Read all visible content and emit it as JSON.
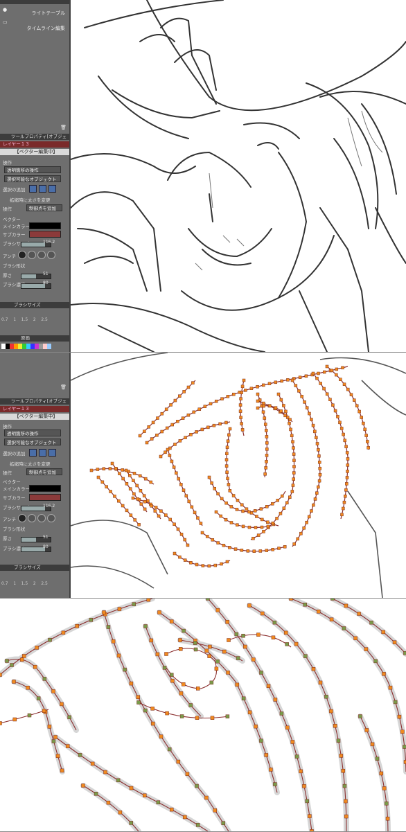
{
  "panel1": {
    "light_table": "ライトテーブル",
    "timeline_edit": "タイムライン編集",
    "tool_property": "ツールプロパティ[オブジェ",
    "layer": "レイヤー１３",
    "editing_banner": "【ベクター編集中】",
    "operation_header": "操作",
    "op_transparent": "透明箇所の操作",
    "op_selectable": "選択可能なオブジェクト",
    "add_selection": "選択の追加",
    "checkbox_thickness": "拡縮時に太さを変更",
    "operation_label": "操作",
    "operation_value": "制御点を追加",
    "vector_header": "ベクター",
    "main_color": "メインカラー",
    "sub_color": "サブカラー",
    "brush_size": "ブラシサイズ",
    "brush_size_value": "116.2",
    "antialias": "アンチ",
    "brush_shape": "ブラシ形状",
    "thickness": "厚さ",
    "thickness_value": "51",
    "brush_density": "ブラシ濃度",
    "brush_density_value": "80",
    "brush_size_panel": "ブラシサイズ",
    "ticks": [
      "0.7",
      "1",
      "1.5",
      "2",
      "2.5"
    ],
    "canvas_tab": "原画"
  },
  "panel2": {
    "tool_property": "ツールプロパティ[オブジェ",
    "layer": "レイヤー１３",
    "editing_banner": "【ベクター編集中】",
    "operation_header": "操作",
    "op_transparent": "透明箇所の操作",
    "op_selectable": "選択可能なオブジェクト",
    "add_selection": "選択の追加",
    "checkbox_thickness": "拡縮時に太さを変更",
    "operation_label": "操作",
    "operation_value": "制御点を追加",
    "vector_header": "ベクター",
    "main_color": "メインカラー",
    "sub_color": "サブカラー",
    "brush_size": "ブラシサイズ",
    "brush_size_value": "116.2",
    "antialias": "アンチ",
    "brush_shape": "ブラシ形状",
    "thickness": "厚さ",
    "thickness_value": "51",
    "brush_density": "ブラシ濃度",
    "brush_density_value": "80",
    "brush_size_panel": "ブラシサイズ",
    "ticks": [
      "0.7",
      "1",
      "1.5",
      "2",
      "2.5"
    ]
  },
  "colors": {
    "panel_bg": "#6e6e6e",
    "main_color": "#000000",
    "sub_color": "#8b3a3a",
    "vector_line": "#8b2f2f",
    "control_point": "#f08a20",
    "control_point_green": "#7a9a4a"
  }
}
